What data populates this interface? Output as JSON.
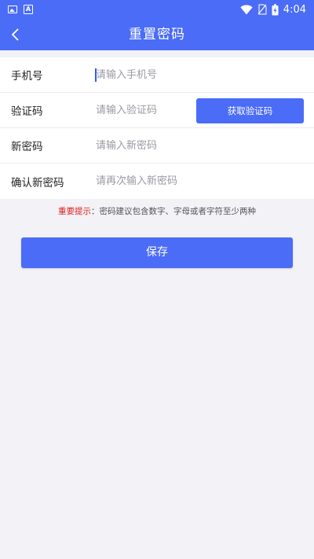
{
  "status_bar": {
    "time": "4:04",
    "left_icons": [
      "gallery-icon",
      "font-a-icon"
    ],
    "right_icons": [
      "wifi-icon",
      "no-sim-icon",
      "battery-charging-icon"
    ]
  },
  "app_bar": {
    "title": "重置密码",
    "back_icon": "chevron-left-icon"
  },
  "form": {
    "phone": {
      "label": "手机号",
      "placeholder": "请输入手机号",
      "value": ""
    },
    "code": {
      "label": "验证码",
      "placeholder": "请输入验证码",
      "value": "",
      "button_label": "获取验证码"
    },
    "new_password": {
      "label": "新密码",
      "placeholder": "请输入新密码",
      "value": ""
    },
    "confirm_password": {
      "label": "确认新密码",
      "placeholder": "请再次输入新密码",
      "value": ""
    }
  },
  "hint": {
    "emphasis": "重要提示",
    "separator": "：",
    "text": "密码建议包含数字、字母或者字符至少两种"
  },
  "save_button": {
    "label": "保存"
  },
  "colors": {
    "primary": "#4a6cf7",
    "background": "#f2f2f7",
    "hint_emphasis": "#e02020"
  }
}
